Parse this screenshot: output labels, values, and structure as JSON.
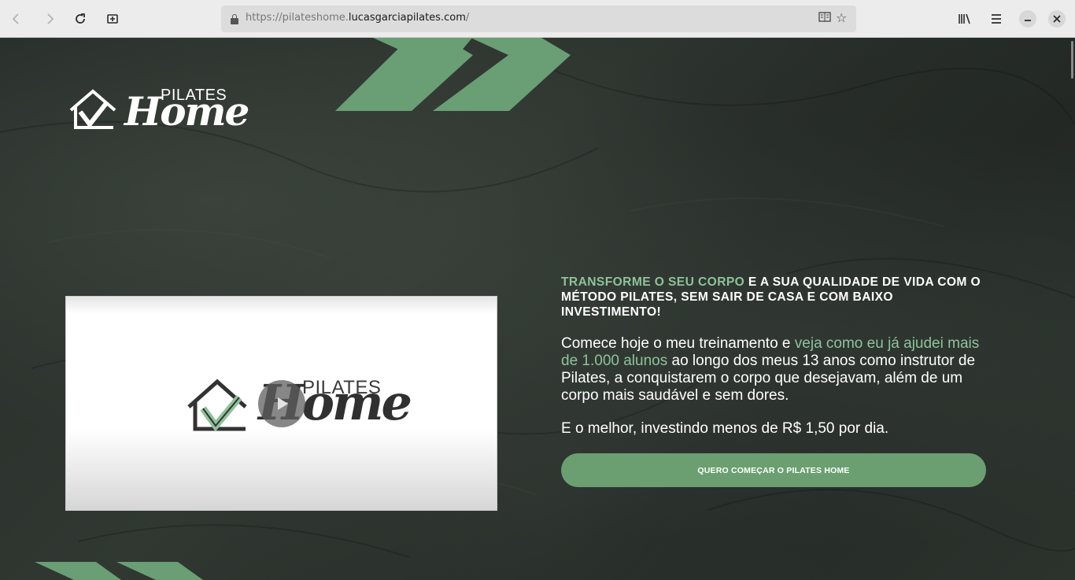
{
  "browser": {
    "url_prefix": "https://pilateshome.",
    "url_domain": "lucasgarciapilates.com",
    "url_suffix": "/",
    "icons": {
      "back": "arrow-left-icon",
      "forward": "arrow-right-icon",
      "reload": "reload-icon",
      "new_tab": "container-icon",
      "reader": "reader-view-icon",
      "bookmark": "star-icon",
      "library": "library-icon",
      "menu": "hamburger-icon",
      "minimize": "minimize-icon",
      "close": "close-icon"
    }
  },
  "page": {
    "logo": {
      "pilates": "PILATES",
      "home": "Home"
    },
    "video": {
      "pilates": "PILATES",
      "home": "Home"
    },
    "headline": {
      "highlight": "TRANSFORME O SEU CORPO",
      "rest": " E A SUA QUALIDADE DE VIDA COM O MÉTODO PILATES, SEM SAIR DE CASA E COM BAIXO INVESTIMENTO!"
    },
    "paragraph1": {
      "before": "Comece hoje o meu treinamento e ",
      "highlight": "veja como eu já ajudei mais de 1.000 alunos",
      "after": " ao longo dos meus 13 anos como instrutor de Pilates, a conquistarem o corpo que desejavam, além de um corpo mais saudável e sem dores."
    },
    "paragraph2": "E o melhor, investindo menos de R$ 1,50 por dia.",
    "cta_label": "QUERO COMEÇAR O PILATES HOME"
  },
  "colors": {
    "accent_green": "#6b9f72",
    "highlight_green": "#8fc29a",
    "chevron_green": "#6a9e74",
    "background_dark": "#262c28"
  }
}
